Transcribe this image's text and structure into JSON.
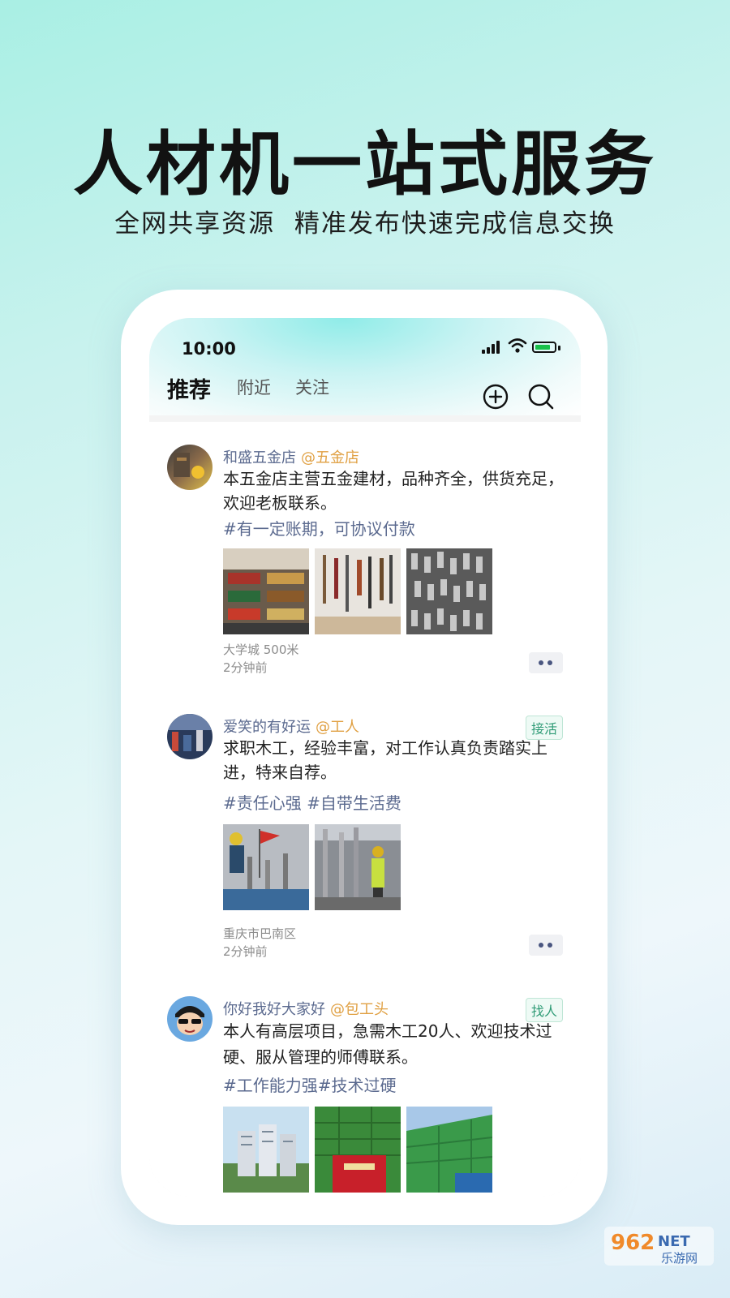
{
  "promo": {
    "headline": "人材机一站式服务",
    "subline": "全网共享资源  精准发布快速完成信息交换"
  },
  "status_bar": {
    "time": "10:00",
    "battery_color": "#19c04a"
  },
  "header": {
    "tabs": [
      {
        "label": "推荐",
        "active": true
      },
      {
        "label": "附近",
        "active": false
      },
      {
        "label": "关注",
        "active": false
      }
    ],
    "icons": [
      "plus-circle-icon",
      "search-icon"
    ]
  },
  "posts": [
    {
      "name": "和盛五金店",
      "handle": "@五金店",
      "badge": "",
      "text": "本五金店主营五金建材，品种齐全，供货充足，欢迎老板联系。",
      "tags": "#有一定账期，可协议付款",
      "location": "大学城  500米",
      "time": "2分钟前"
    },
    {
      "name": "爱笑的有好运",
      "handle": "@工人",
      "badge": "接活",
      "text": "求职木工，经验丰富，对工作认真负责踏实上进，特来自荐。",
      "tags": "#责任心强 #自带生活费",
      "location": "重庆市巴南区",
      "time": "2分钟前"
    },
    {
      "name": "你好我好大家好",
      "handle": "@包工头",
      "badge": "找人",
      "text": "本人有高层项目，急需木工20人、欢迎技术过硬、服从管理的师傅联系。",
      "tags": "#工作能力强#技术过硬",
      "location": "",
      "time": ""
    }
  ],
  "colors": {
    "name": "#5b6a8f",
    "handle": "#e0a043",
    "badge": "#2f9b76"
  },
  "watermark": {
    "text": "962NET",
    "sub": "乐游网"
  }
}
